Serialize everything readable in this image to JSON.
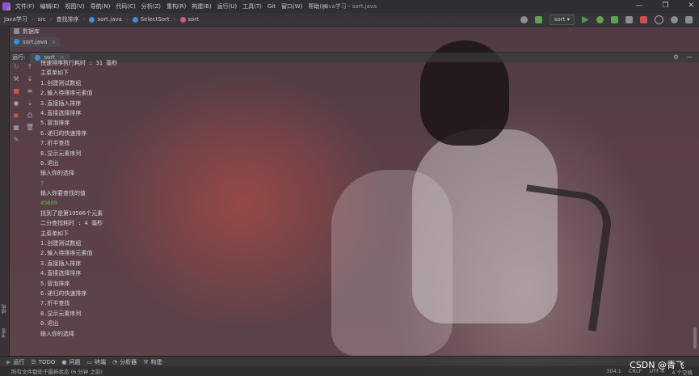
{
  "titlebar": {
    "menu": [
      "文件(F)",
      "编辑(E)",
      "视图(V)",
      "导航(N)",
      "代码(C)",
      "分析(Z)",
      "重构(R)",
      "构建(B)",
      "运行(U)",
      "工具(T)",
      "Git",
      "窗口(W)",
      "帮助(H)"
    ],
    "window_title": "Java学习 - sort.java",
    "min_glyph": "—",
    "max_glyph": "❐",
    "close_glyph": "✕"
  },
  "navbar": {
    "breadcrumbs": [
      "Java学习",
      "src",
      "查找排序",
      "sort.java",
      "SelectSort",
      "sort"
    ],
    "run_config": "sort ▾"
  },
  "project_tab": "数据库",
  "editor_tabs": [
    {
      "label": "sort.java"
    }
  ],
  "run_panel": {
    "label": "运行:",
    "tab": "sort",
    "settings_glyph": "⚙",
    "minimize_glyph": "—"
  },
  "console_lines": [
    {
      "text": "快速排序执行耗时 : 31 毫秒",
      "color": "default"
    },
    {
      "text": "主菜单如下",
      "color": "default"
    },
    {
      "text": "1.创建测试数组",
      "color": "default"
    },
    {
      "text": "2.输入待排序元素值",
      "color": "default"
    },
    {
      "text": "3.直接插入排序",
      "color": "default"
    },
    {
      "text": "4.直接选择排序",
      "color": "default"
    },
    {
      "text": "5.冒泡排序",
      "color": "default"
    },
    {
      "text": "6.递归的快速排序",
      "color": "default"
    },
    {
      "text": "7.折半查找",
      "color": "default"
    },
    {
      "text": "8.显示元素序列",
      "color": "default"
    },
    {
      "text": "0.退出",
      "color": "default"
    },
    {
      "text": "输入你的选择",
      "color": "default"
    },
    {
      "text": "7",
      "color": "green"
    },
    {
      "text": "输入你要查找的值",
      "color": "default"
    },
    {
      "text": "45689",
      "color": "green"
    },
    {
      "text": "找到了是第19506个元素",
      "color": "default"
    },
    {
      "text": "二分查找耗时 : 4 毫秒",
      "color": "default"
    },
    {
      "text": "主菜单如下",
      "color": "default"
    },
    {
      "text": "1.创建测试数组",
      "color": "default"
    },
    {
      "text": "2.输入待排序元素值",
      "color": "default"
    },
    {
      "text": "3.直接插入排序",
      "color": "default"
    },
    {
      "text": "4.直接选择排序",
      "color": "default"
    },
    {
      "text": "5.冒泡排序",
      "color": "default"
    },
    {
      "text": "6.递归的快速排序",
      "color": "default"
    },
    {
      "text": "7.折半查找",
      "color": "default"
    },
    {
      "text": "8.显示元素序列",
      "color": "default"
    },
    {
      "text": "0.退出",
      "color": "default"
    },
    {
      "text": "输入你的选择",
      "color": "default"
    }
  ],
  "side_labels": {
    "structure": "结构",
    "bookmarks": "书签"
  },
  "bottom_tabs": [
    {
      "label": "运行",
      "icon": "▶"
    },
    {
      "label": "TODO",
      "icon": "☰"
    },
    {
      "label": "问题",
      "icon": "●"
    },
    {
      "label": "终端",
      "icon": "▭"
    },
    {
      "label": "分析器",
      "icon": "◔"
    },
    {
      "label": "构建",
      "icon": "⚒"
    }
  ],
  "statusbar": {
    "message": "所有文件都处于最新状态 (6 分钟 之前)",
    "position": "304:1",
    "line_sep": "CRLF",
    "encoding": "UTF-8",
    "indent": "4 个空格"
  },
  "watermark": "CSDN @青飞",
  "colors": {
    "console_green": "#62b543",
    "accent_run": "#499c54"
  }
}
